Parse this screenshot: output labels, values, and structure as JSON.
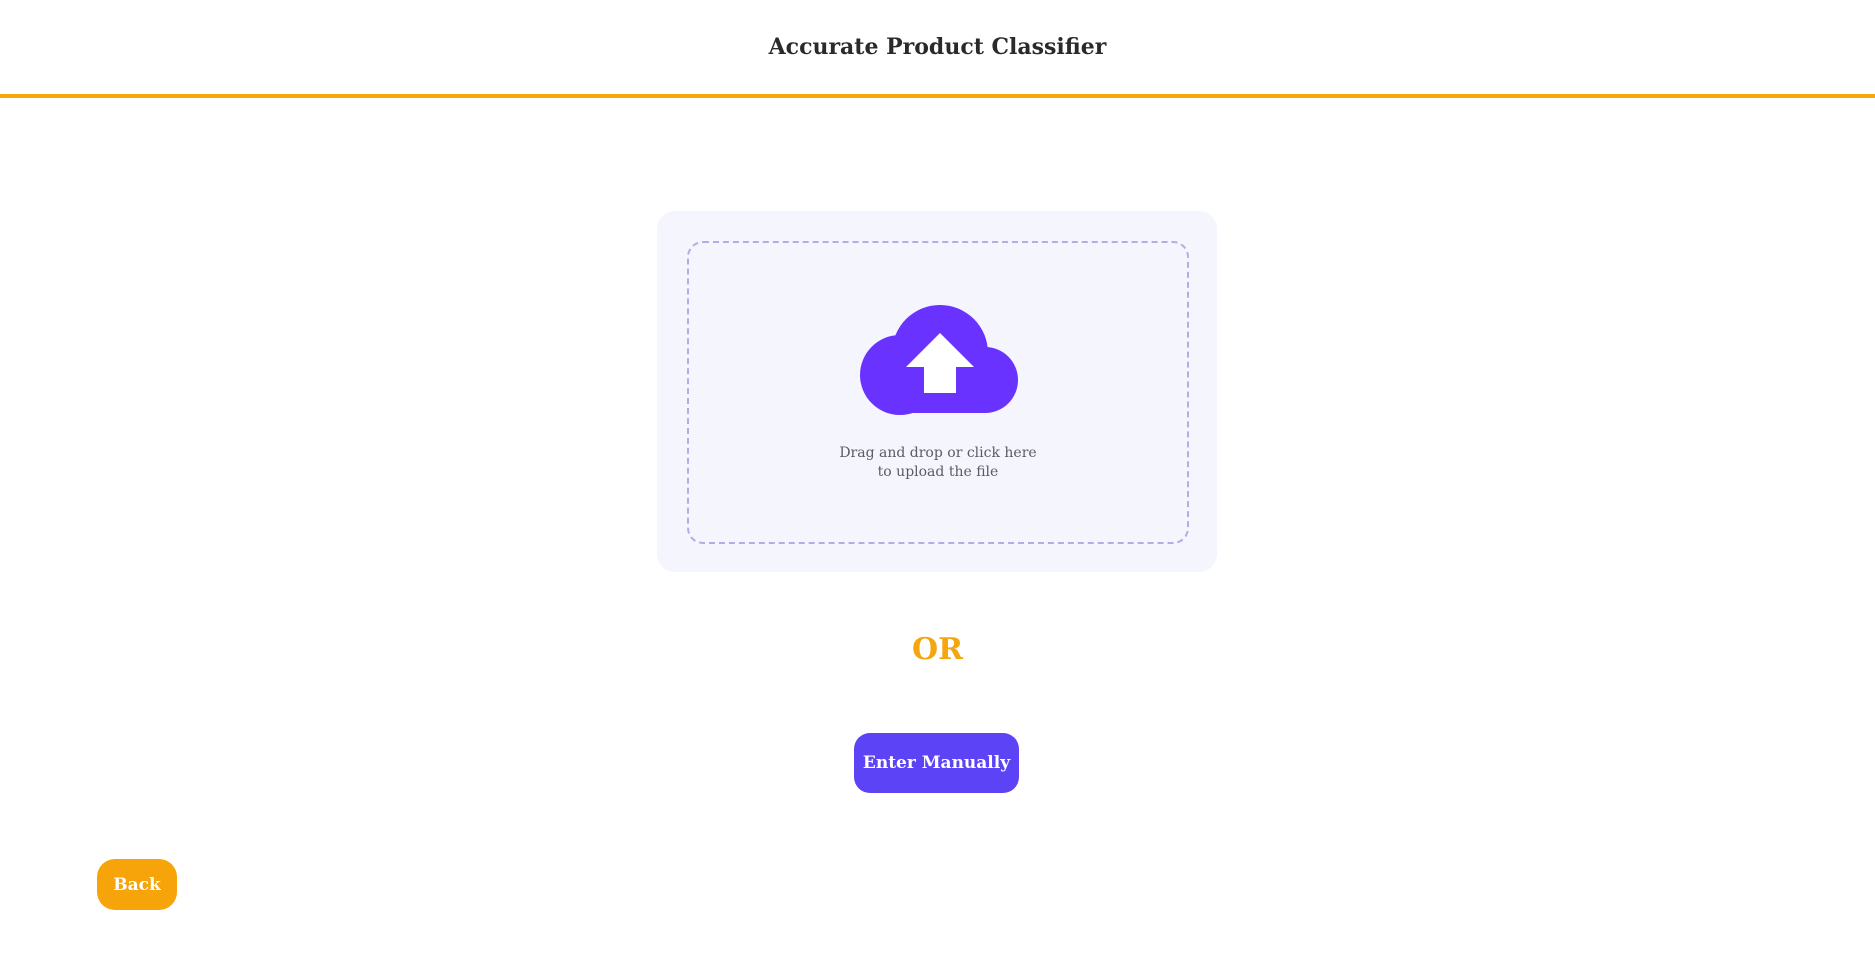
{
  "header": {
    "title": "Accurate Product Classifier"
  },
  "upload": {
    "icon": "cloud-upload-icon",
    "line1": "Drag and drop or click here",
    "line2": "to upload the file"
  },
  "divider": {
    "or_text": "OR"
  },
  "actions": {
    "enter_manually_label": "Enter Manually",
    "back_label": "Back"
  },
  "colors": {
    "accent_orange": "#f5a70f",
    "primary_purple": "#5c44f6",
    "icon_purple": "#6a32ff",
    "card_bg": "#f5f5fe"
  }
}
